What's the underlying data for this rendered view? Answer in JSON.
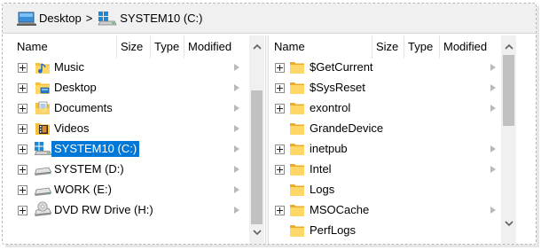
{
  "breadcrumb": [
    {
      "label": "Desktop",
      "icon": "desktop-icon"
    },
    {
      "label": "SYSTEM10 (C:)",
      "icon": "windows-drive-icon"
    }
  ],
  "breadcrumb_separator": ">",
  "left_pane": {
    "columns": [
      "Name",
      "Size",
      "Type",
      "Modified"
    ],
    "items": [
      {
        "label": "Music",
        "icon": "music-folder-icon"
      },
      {
        "label": "Desktop",
        "icon": "desktop-folder-icon"
      },
      {
        "label": "Documents",
        "icon": "documents-folder-icon"
      },
      {
        "label": "Videos",
        "icon": "videos-folder-icon"
      },
      {
        "label": "SYSTEM10 (C:)",
        "icon": "windows-drive-icon",
        "selected": true
      },
      {
        "label": "SYSTEM (D:)",
        "icon": "drive-icon"
      },
      {
        "label": "WORK (E:)",
        "icon": "drive-icon"
      },
      {
        "label": "DVD RW Drive (H:)",
        "icon": "dvd-drive-icon"
      }
    ]
  },
  "right_pane": {
    "columns": [
      "Name",
      "Size",
      "Type",
      "Modified"
    ],
    "items": [
      {
        "label": "$GetCurrent",
        "icon": "folder-icon",
        "expandable": true
      },
      {
        "label": "$SysReset",
        "icon": "folder-icon",
        "expandable": true
      },
      {
        "label": "exontrol",
        "icon": "folder-icon",
        "expandable": true
      },
      {
        "label": "GrandeDevice",
        "icon": "folder-icon",
        "expandable": false
      },
      {
        "label": "inetpub",
        "icon": "folder-icon",
        "expandable": true
      },
      {
        "label": "Intel",
        "icon": "folder-icon",
        "expandable": true
      },
      {
        "label": "Logs",
        "icon": "folder-icon",
        "expandable": false
      },
      {
        "label": "MSOCache",
        "icon": "folder-icon",
        "expandable": true
      },
      {
        "label": "PerfLogs",
        "icon": "folder-icon",
        "expandable": false
      }
    ]
  },
  "colors": {
    "selection": "#0078d7",
    "folder": "#f5c13a",
    "chrome": "#f0f0f0"
  }
}
